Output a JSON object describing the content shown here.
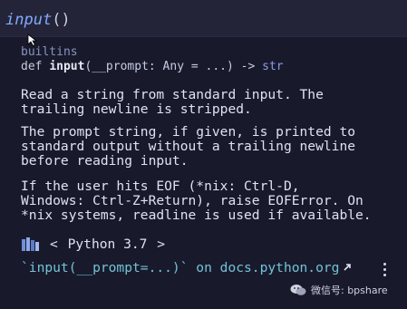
{
  "editor": {
    "function_name": "input",
    "parens": "()"
  },
  "hover": {
    "module": "builtins",
    "signature": {
      "keyword": "def ",
      "name": "input",
      "params": "(__prompt: Any = ...)",
      "arrow": " -> ",
      "return_type": "str"
    },
    "paragraphs": [
      "Read a string from standard input. The\ntrailing newline is stripped.",
      "The prompt string, if given, is printed to\nstandard output without a trailing newline\nbefore reading input.",
      "If the user hits EOF (*nix: Ctrl-D,\nWindows: Ctrl-Z+Return), raise EOFError. On\n*nix systems, readline is used if available."
    ],
    "version": {
      "prev": "<",
      "label": "Python 3.7",
      "next": ">"
    },
    "doc_link": {
      "code": "`input(__prompt=...)`",
      "text": " on docs.python.org",
      "icon": "external-link-icon"
    },
    "more_icon": "kebab-menu-icon"
  },
  "watermark": {
    "text": "微信号: bpshare",
    "icon": "wechat-icon"
  },
  "colors": {
    "background": "#181a2b",
    "editor_bg": "#232438",
    "function": "#82aaff",
    "link": "#73c2d8",
    "text": "#dfe2f0"
  }
}
